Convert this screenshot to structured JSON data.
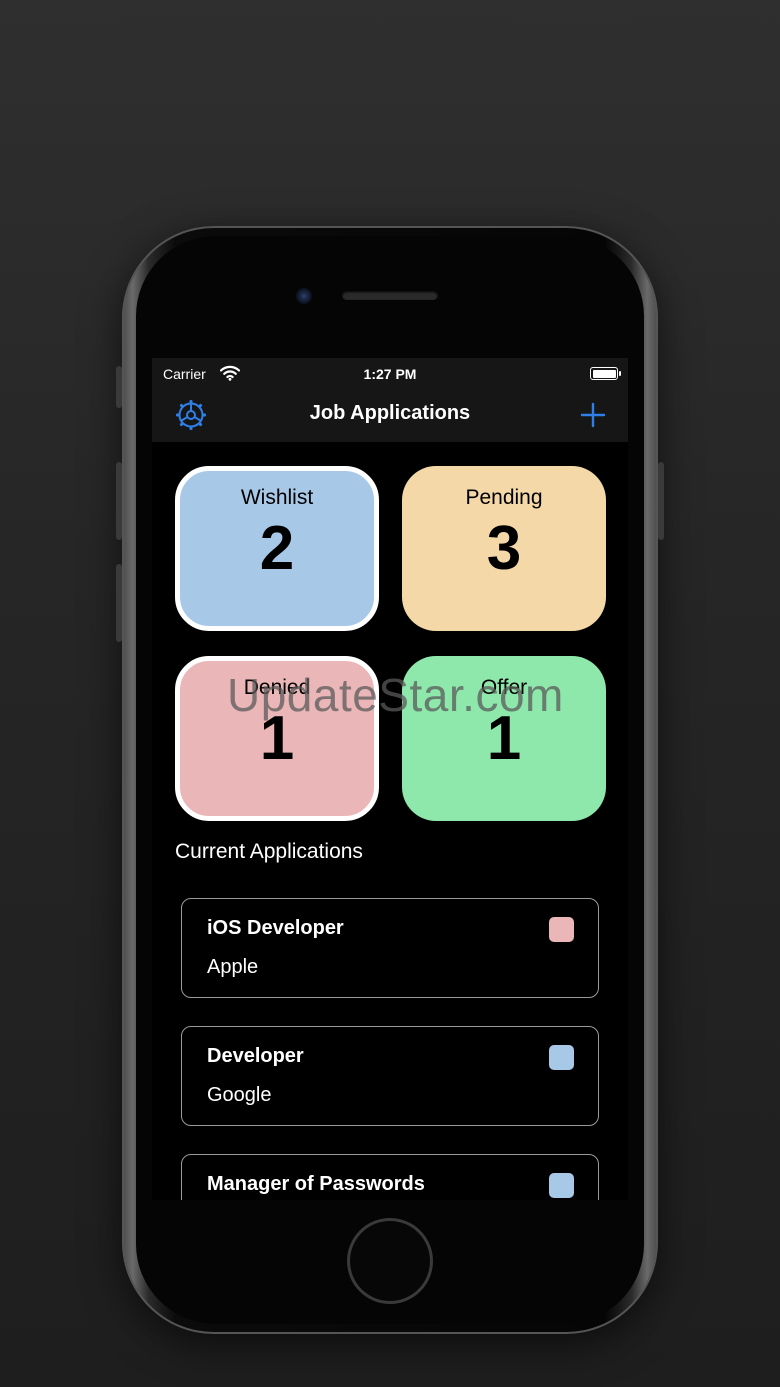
{
  "status_bar": {
    "carrier": "Carrier",
    "time": "1:27 PM"
  },
  "nav": {
    "title": "Job Applications",
    "left_icon": "gear-icon",
    "right_icon": "plus-icon",
    "accent_color": "#2f7fe8"
  },
  "tiles": [
    {
      "label": "Wishlist",
      "count": "2",
      "color": "#a8c8e8"
    },
    {
      "label": "Pending",
      "count": "3",
      "color": "#f4d8a8"
    },
    {
      "label": "Denied",
      "count": "1",
      "color": "#ebb6b8"
    },
    {
      "label": "Offer",
      "count": "1",
      "color": "#8ee8ac"
    }
  ],
  "section_title": "Current Applications",
  "applications": [
    {
      "role": "iOS Developer",
      "company": "Apple",
      "status_color": "#ebb6b8"
    },
    {
      "role": "Developer",
      "company": "Google",
      "status_color": "#a8c8e8"
    },
    {
      "role": "Manager of Passwords",
      "company": "",
      "status_color": "#a8c8e8"
    }
  ],
  "watermark": "UpdateStar.com"
}
